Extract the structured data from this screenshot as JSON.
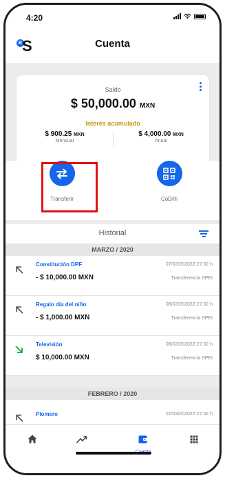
{
  "status": {
    "time": "4:20"
  },
  "header": {
    "logo_badge": "B",
    "logo_letter": "S",
    "title": "Cuenta"
  },
  "card": {
    "saldo_label": "Saldo",
    "saldo_amount": "$ 50,000.00",
    "saldo_currency": "MXN",
    "interes_label": "Interés acumulado",
    "mensual": {
      "amount": "$ 900.25",
      "currency": "MXN",
      "label": "Mensual"
    },
    "anual": {
      "amount": "$ 4,000.00",
      "currency": "MXN",
      "label": "Anual"
    }
  },
  "actions": {
    "transfer_label": "Transferir",
    "codi_label": "CoDI®"
  },
  "historial": {
    "label": "Historial"
  },
  "sections": {
    "marzo": "MARZO / 2020",
    "febrero": "FEBRERO / 2020"
  },
  "transactions": [
    {
      "name": "Constitución DPF",
      "amount": "- $ 10,000.00 MXN",
      "date": "07/03/202022:27:32 h",
      "method": "Transferencia SPEI",
      "direction": "out"
    },
    {
      "name": "Regalo día del niño",
      "amount": "- $ 1,000.00 MXN",
      "date": "06/03/202022:27:32 h",
      "method": "Transferencia SPEI",
      "direction": "out"
    },
    {
      "name": "Televisión",
      "amount": "$ 10,000.00 MXN",
      "date": "06/03/202022:27:32 h",
      "method": "Transferencia SPEI",
      "direction": "in"
    },
    {
      "name": "Plomero",
      "date": "07/03/202022:27:32 h",
      "direction": "out"
    }
  ],
  "tabbar": {
    "cuenta_label": "Cuenta"
  },
  "colors": {
    "accent": "#1467e8",
    "gold": "#c49a12",
    "incoming": "#1aa53a",
    "highlight": "#e01010"
  }
}
